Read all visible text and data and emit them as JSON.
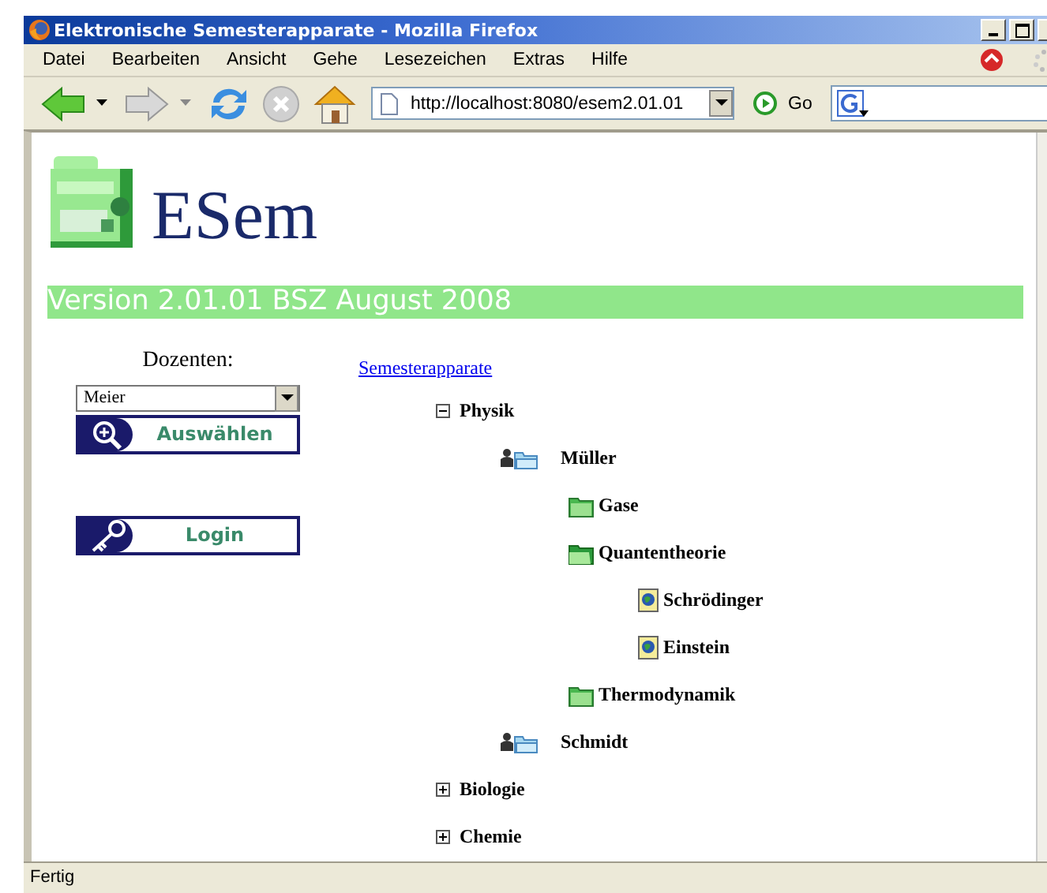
{
  "window": {
    "title": "Elektronische Semesterapparate - Mozilla Firefox"
  },
  "menu": [
    "Datei",
    "Bearbeiten",
    "Ansicht",
    "Gehe",
    "Lesezeichen",
    "Extras",
    "Hilfe"
  ],
  "toolbar": {
    "url": "http://localhost:8080/esem2.01.01",
    "go": "Go"
  },
  "page": {
    "logo": "ESem",
    "version": "Version 2.01.01 BSZ August 2008",
    "dozenten_label": "Dozenten:",
    "dozent_select": "Meier",
    "buttons": [
      {
        "label": "Auswählen",
        "kind": "search"
      },
      {
        "label": "Login",
        "kind": "login"
      }
    ],
    "breadcrumb": "Semesterapparate",
    "tree": [
      {
        "label": "Physik",
        "kind": "category",
        "expanded": true,
        "children": [
          {
            "label": "Müller",
            "kind": "person",
            "children": [
              {
                "label": "Gase",
                "kind": "folder",
                "expanded": false
              },
              {
                "label": "Quantentheorie",
                "kind": "folder",
                "expanded": true,
                "children": [
                  {
                    "label": "Schrödinger",
                    "kind": "document"
                  },
                  {
                    "label": "Einstein",
                    "kind": "document"
                  }
                ]
              },
              {
                "label": "Thermodynamik",
                "kind": "folder",
                "expanded": false
              }
            ]
          },
          {
            "label": "Schmidt",
            "kind": "person"
          }
        ]
      },
      {
        "label": "Biologie",
        "kind": "category",
        "expanded": false
      },
      {
        "label": "Chemie",
        "kind": "category",
        "expanded": false
      }
    ]
  },
  "status_bar": "Fertig"
}
